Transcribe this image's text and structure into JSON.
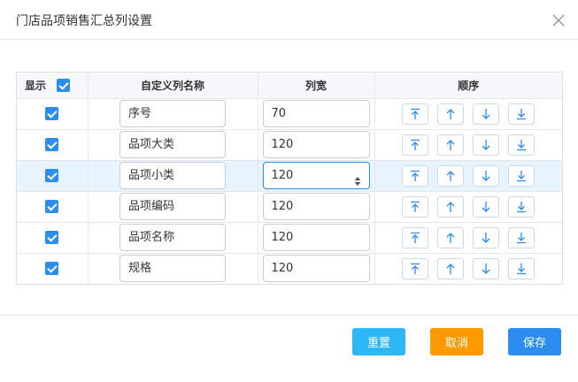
{
  "dialog": {
    "title": "门店品项销售汇总列设置"
  },
  "table": {
    "headers": {
      "show": "显示",
      "name": "自定义列名称",
      "width": "列宽",
      "order": "顺序"
    },
    "rows": [
      {
        "name": "序号",
        "width": "70"
      },
      {
        "name": "品项大类",
        "width": "120"
      },
      {
        "name": "品项小类",
        "width": "120"
      },
      {
        "name": "品项编码",
        "width": "120"
      },
      {
        "name": "品项名称",
        "width": "120"
      },
      {
        "name": "规格",
        "width": "120"
      }
    ]
  },
  "footer": {
    "reset_label": "重置",
    "cancel_label": "取消",
    "save_label": "保存"
  },
  "colors": {
    "primary": "#2d8cf0",
    "info": "#2db7f5",
    "warning": "#ff9900",
    "row_highlight": "#e8f4fd"
  },
  "icons": [
    "close-icon",
    "move-top-icon",
    "move-up-icon",
    "move-down-icon",
    "move-bottom-icon",
    "spinner-icon",
    "checkmark-icon"
  ]
}
